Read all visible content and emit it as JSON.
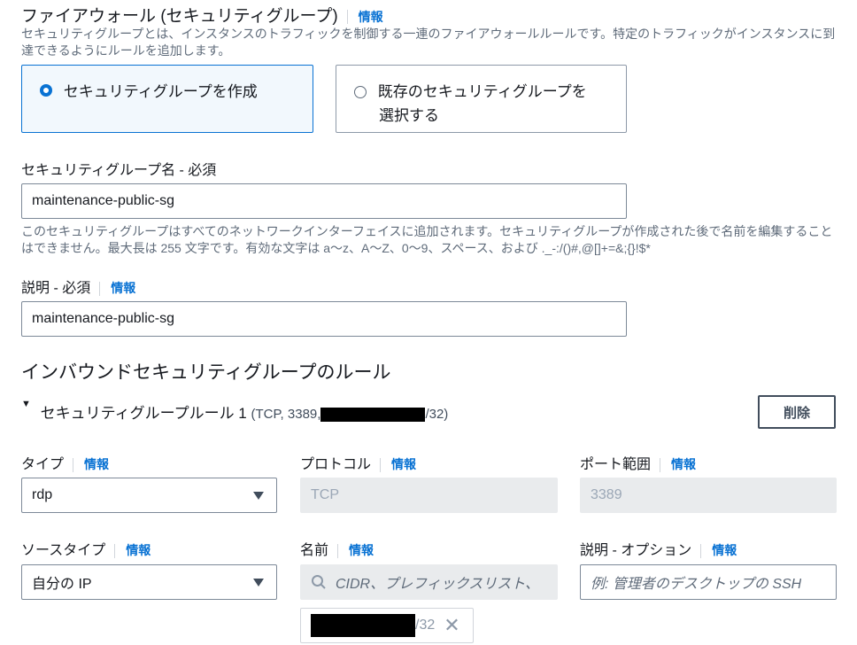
{
  "section": {
    "title": "ファイアウォール (セキュリティグループ)",
    "info": "情報",
    "description": "セキュリティグループとは、インスタンスのトラフィックを制御する一連のファイアウォールルールです。特定のトラフィックがインスタンスに到達できるようにルールを追加します。"
  },
  "sg_options": {
    "create": "セキュリティグループを作成",
    "existing_line1": "既存のセキュリティグループを",
    "existing_line2": "選択する"
  },
  "sg_name": {
    "label": "セキュリティグループ名 - 必須",
    "value": "maintenance-public-sg",
    "hint": "このセキュリティグループはすべてのネットワークインターフェイスに追加されます。セキュリティグループが作成された後で名前を編集することはできません。最大長は 255 文字です。有効な文字は a～z、A～Z、0～9、スペース、および ._-:/()#,@[]+=&;{}!$*"
  },
  "description_field": {
    "label": "説明 - 必須",
    "info": "情報",
    "value": "maintenance-public-sg"
  },
  "inbound": {
    "title": "インバウンドセキュリティグループのルール",
    "rule_title": "セキュリティグループルール 1",
    "rule_detail_prefix": "(TCP, 3389,",
    "rule_detail_suffix": "/32)",
    "delete_label": "削除"
  },
  "fields": {
    "type_label": "タイプ",
    "type_value": "rdp",
    "protocol_label": "プロトコル",
    "protocol_value": "TCP",
    "port_label": "ポート範囲",
    "port_value": "3389",
    "source_type_label": "ソースタイプ",
    "source_type_value": "自分の IP",
    "name_label": "名前",
    "name_placeholder": "CIDR、プレフィックスリスト、",
    "desc_opt_label": "説明 - オプション",
    "desc_opt_placeholder": "例: 管理者のデスクトップの SSH",
    "token_suffix": "/32",
    "info": "情報"
  },
  "colors": {
    "accent": "#0972d3",
    "text": "#16191f",
    "muted": "#5f6b7a",
    "disabled_bg": "#e9ebed"
  }
}
